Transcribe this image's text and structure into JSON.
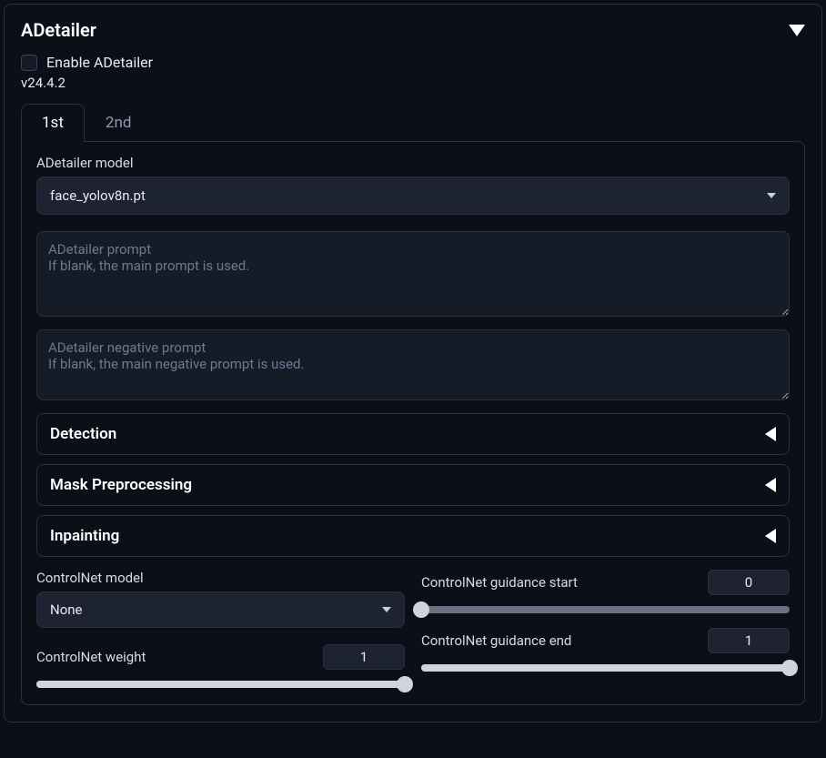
{
  "header": {
    "title": "ADetailer"
  },
  "enable": {
    "label": "Enable ADetailer"
  },
  "version": "v24.4.2",
  "tabs": [
    {
      "label": "1st"
    },
    {
      "label": "2nd"
    }
  ],
  "model": {
    "label": "ADetailer model",
    "value": "face_yolov8n.pt"
  },
  "prompt": {
    "placeholder": "ADetailer prompt\nIf blank, the main prompt is used."
  },
  "neg_prompt": {
    "placeholder": "ADetailer negative prompt\nIf blank, the main negative prompt is used."
  },
  "accordions": {
    "detection": "Detection",
    "mask": "Mask Preprocessing",
    "inpainting": "Inpainting"
  },
  "cn": {
    "model_label": "ControlNet model",
    "model_value": "None",
    "weight_label": "ControlNet weight",
    "weight_value": "1",
    "gstart_label": "ControlNet guidance start",
    "gstart_value": "0",
    "gend_label": "ControlNet guidance end",
    "gend_value": "1"
  }
}
